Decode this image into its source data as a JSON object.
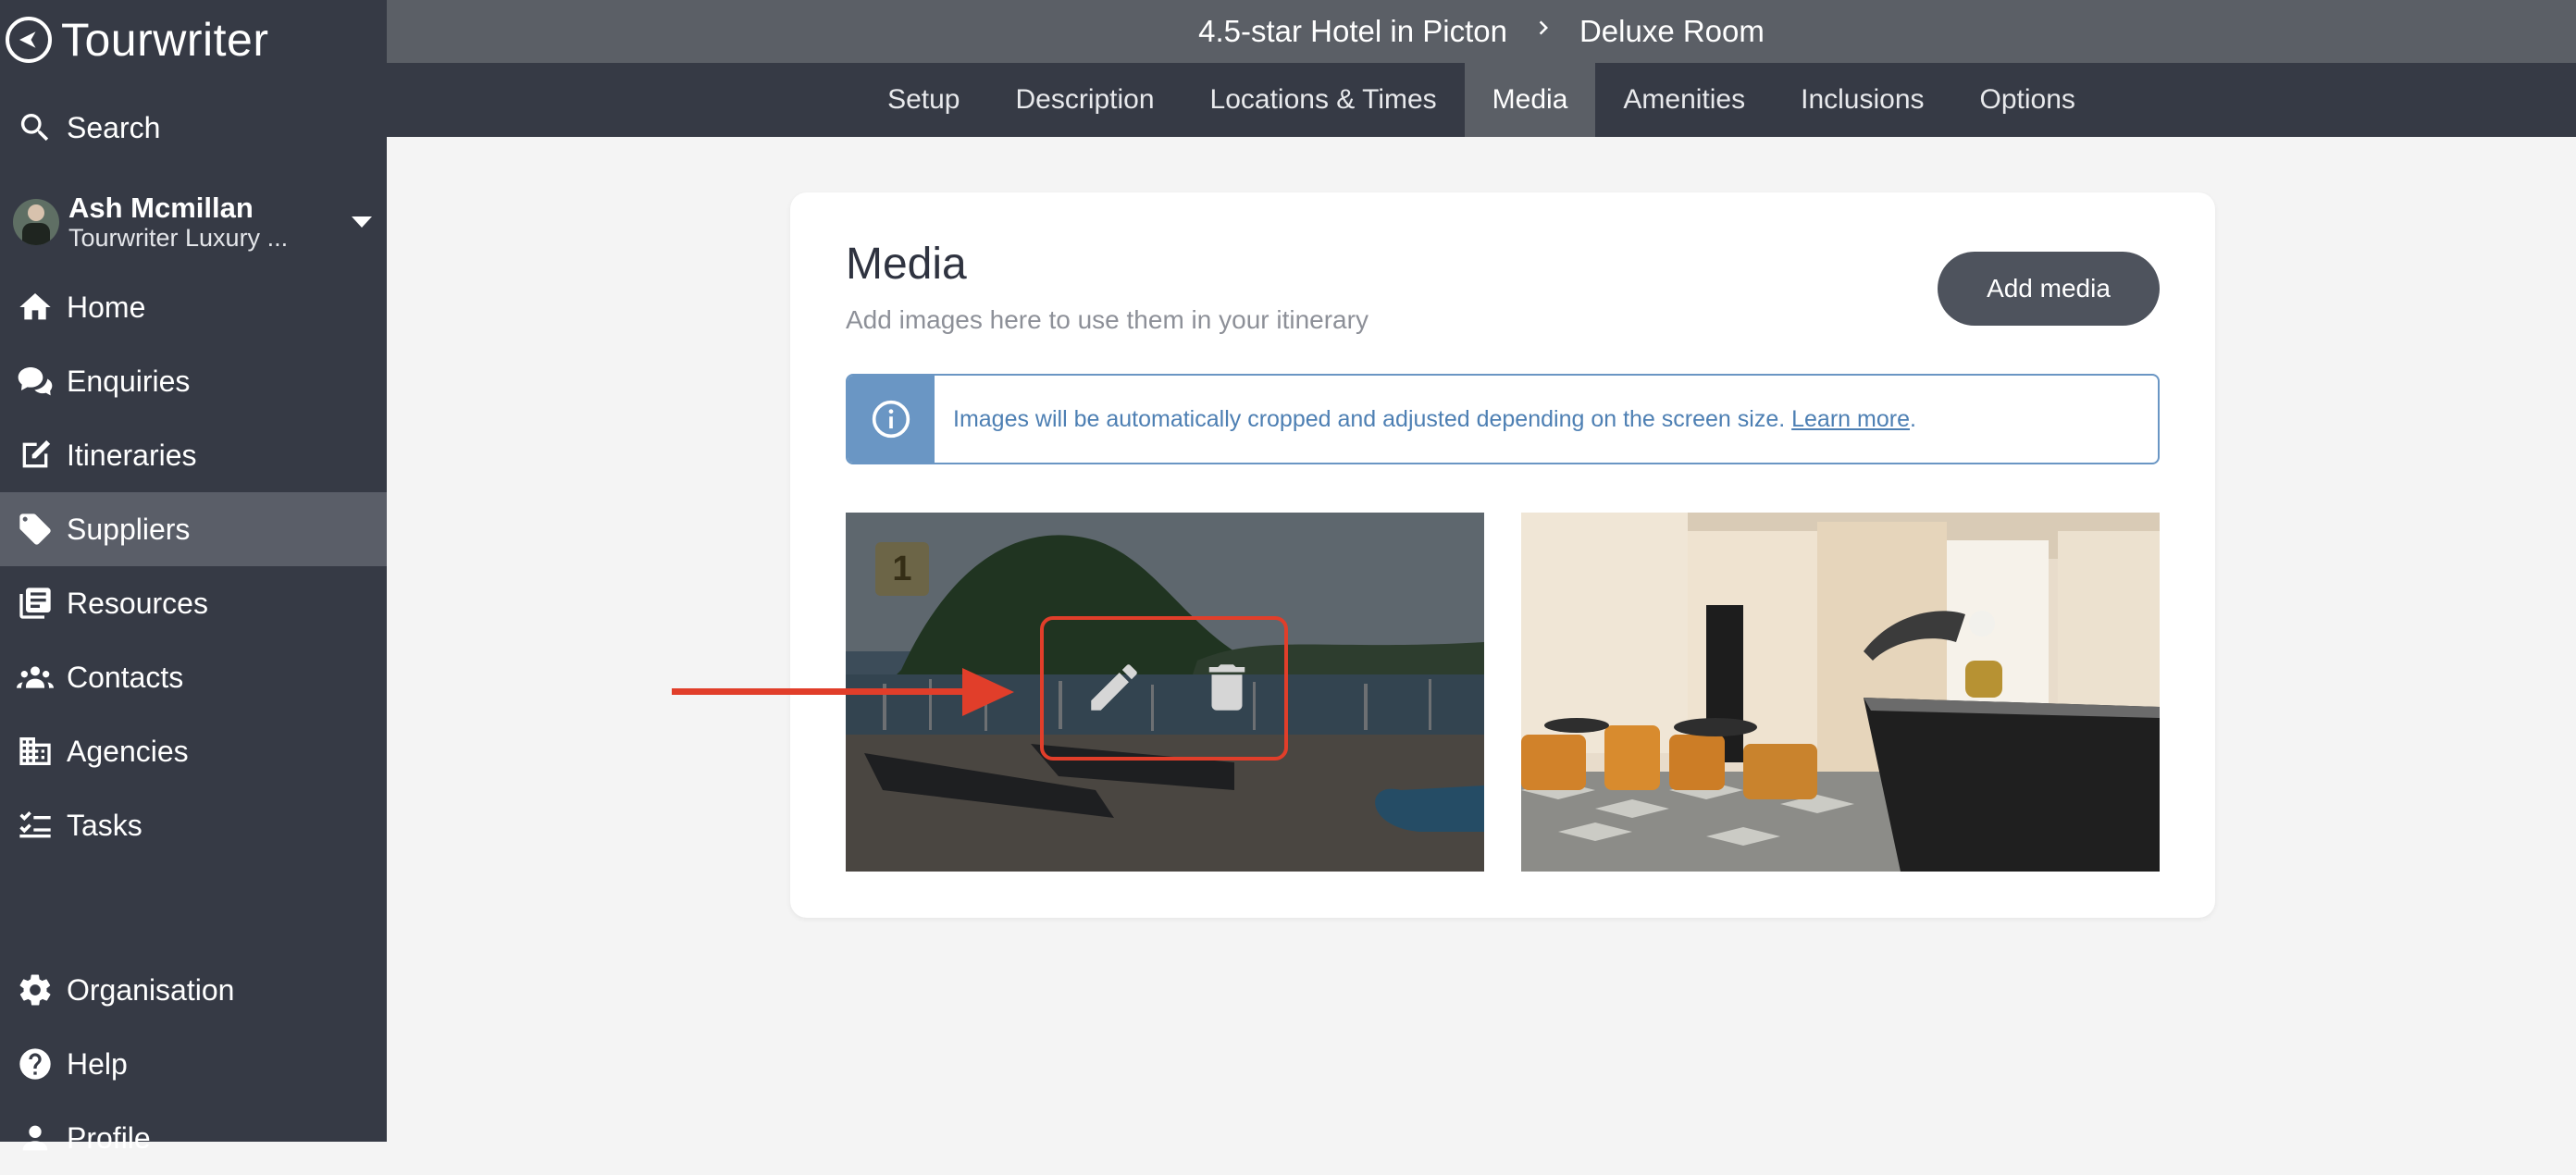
{
  "app": {
    "name": "Tourwriter"
  },
  "sidebar": {
    "search_label": "Search",
    "user": {
      "name": "Ash Mcmillan",
      "org": "Tourwriter Luxury ..."
    },
    "items": [
      {
        "label": "Home",
        "icon": "home-icon"
      },
      {
        "label": "Enquiries",
        "icon": "chat-bubbles-icon"
      },
      {
        "label": "Itineraries",
        "icon": "edit-document-icon"
      },
      {
        "label": "Suppliers",
        "icon": "tag-icon",
        "active": true
      },
      {
        "label": "Resources",
        "icon": "library-icon"
      },
      {
        "label": "Contacts",
        "icon": "people-icon"
      },
      {
        "label": "Agencies",
        "icon": "buildings-icon"
      },
      {
        "label": "Tasks",
        "icon": "checklist-icon"
      }
    ],
    "bottom_items": [
      {
        "label": "Organisation",
        "icon": "gear-icon"
      },
      {
        "label": "Help",
        "icon": "help-icon"
      },
      {
        "label": "Profile",
        "icon": "person-icon"
      }
    ]
  },
  "header": {
    "breadcrumb": [
      "4.5-star Hotel in Picton",
      "Deluxe Room"
    ],
    "tabs": [
      {
        "label": "Setup"
      },
      {
        "label": "Description"
      },
      {
        "label": "Locations & Times"
      },
      {
        "label": "Media",
        "active": true
      },
      {
        "label": "Amenities"
      },
      {
        "label": "Inclusions"
      },
      {
        "label": "Options"
      }
    ]
  },
  "media": {
    "title": "Media",
    "subtitle": "Add images here to use them in your itinerary",
    "add_button": "Add media",
    "info": {
      "text": "Images will be automatically cropped and adjusted depending on the screen size. ",
      "link": "Learn more",
      "suffix": "."
    },
    "tiles": [
      {
        "order": "1",
        "description": "harbour-marina-with-lounge-chairs"
      },
      {
        "description": "hotel-lobby-interior"
      }
    ]
  },
  "colors": {
    "sidebar_bg": "#363a45",
    "active_item": "#5a5e68",
    "accent_blue": "#6a96c4",
    "annotation_red": "#e13e2a"
  }
}
